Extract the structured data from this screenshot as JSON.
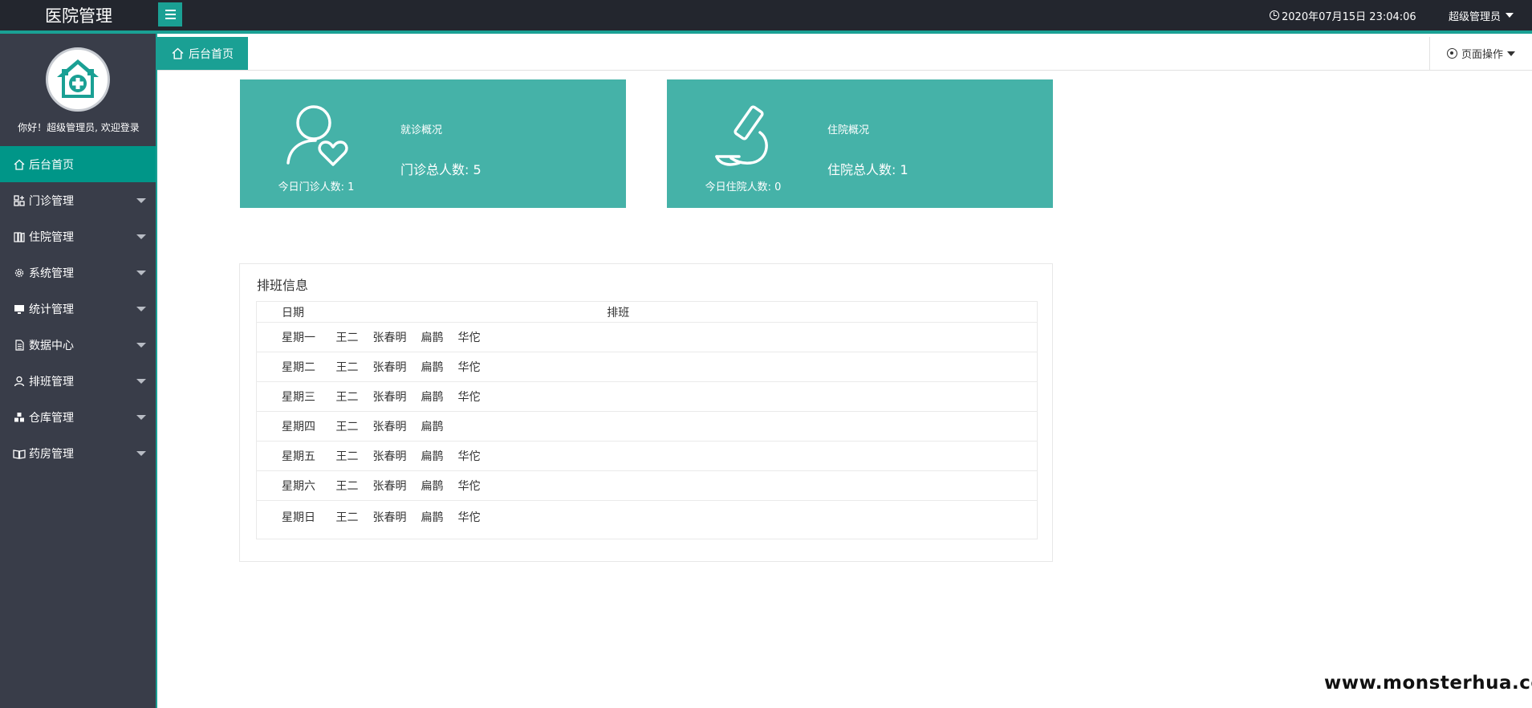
{
  "app": {
    "title": "医院管理"
  },
  "header": {
    "datetime": "2020年07月15日 23:04:06",
    "user_label": "超级管理员"
  },
  "sidebar": {
    "welcome": "你好！超级管理员, 欢迎登录",
    "items": [
      {
        "label": "后台首页",
        "icon": "home-icon",
        "active": true
      },
      {
        "label": "门诊管理",
        "icon": "grid-icon"
      },
      {
        "label": "住院管理",
        "icon": "book-icon"
      },
      {
        "label": "系统管理",
        "icon": "gear-icon"
      },
      {
        "label": "统计管理",
        "icon": "monitor-icon"
      },
      {
        "label": "数据中心",
        "icon": "document-icon"
      },
      {
        "label": "排班管理",
        "icon": "user-icon"
      },
      {
        "label": "仓库管理",
        "icon": "boxes-icon"
      },
      {
        "label": "药房管理",
        "icon": "book-open-icon"
      }
    ]
  },
  "tabs": {
    "home_label": "后台首页",
    "page_ops_label": "页面操作"
  },
  "cards": [
    {
      "title": "就诊概况",
      "total": "门诊总人数: 5",
      "today": "今日门诊人数: 1",
      "icon": "user-heart-icon"
    },
    {
      "title": "住院概况",
      "total": "住院总人数: 1",
      "today": "今日住院人数: 0",
      "icon": "microscope-icon"
    }
  ],
  "schedule": {
    "title": "排班信息",
    "headers": {
      "date": "日期",
      "shift": "排班"
    },
    "rows": [
      {
        "day": "星期一",
        "names": [
          "王二",
          "张春明",
          "扁鹊",
          "华佗"
        ]
      },
      {
        "day": "星期二",
        "names": [
          "王二",
          "张春明",
          "扁鹊",
          "华佗"
        ]
      },
      {
        "day": "星期三",
        "names": [
          "王二",
          "张春明",
          "扁鹊",
          "华佗"
        ]
      },
      {
        "day": "星期四",
        "names": [
          "王二",
          "张春明",
          "扁鹊"
        ]
      },
      {
        "day": "星期五",
        "names": [
          "王二",
          "张春明",
          "扁鹊",
          "华佗"
        ]
      },
      {
        "day": "星期六",
        "names": [
          "王二",
          "张春明",
          "扁鹊",
          "华佗"
        ]
      },
      {
        "day": "星期日",
        "names": [
          "王二",
          "张春明",
          "扁鹊",
          "华佗"
        ]
      }
    ]
  },
  "watermark": "www.monsterhua.com",
  "colors": {
    "accent": "#1aa094",
    "card": "#45b2a8",
    "sidebar": "#393d49",
    "topbar": "#23262e"
  }
}
